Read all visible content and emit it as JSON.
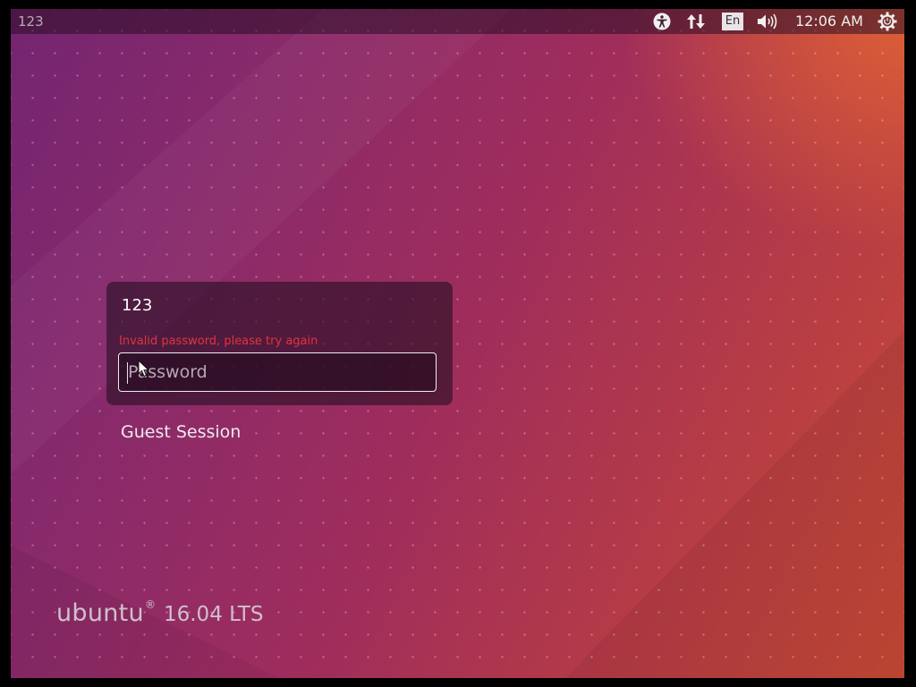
{
  "topbar": {
    "hostname": "123",
    "language": "En",
    "clock": "12:06 AM",
    "icons": [
      "accessibility-icon",
      "network-icon",
      "language-icon",
      "volume-icon",
      "power-gear-icon"
    ]
  },
  "login": {
    "username": "123",
    "error_message": "Invalid password, please try again",
    "password_placeholder": "Password",
    "password_value": ""
  },
  "guest_session_label": "Guest Session",
  "branding": {
    "distro_name": "ubuntu",
    "registered_mark": "®",
    "version": "16.04 LTS"
  },
  "colors": {
    "error": "#e2323f",
    "wallpaper_purple": "#742571",
    "wallpaper_orange": "#c74a35"
  }
}
